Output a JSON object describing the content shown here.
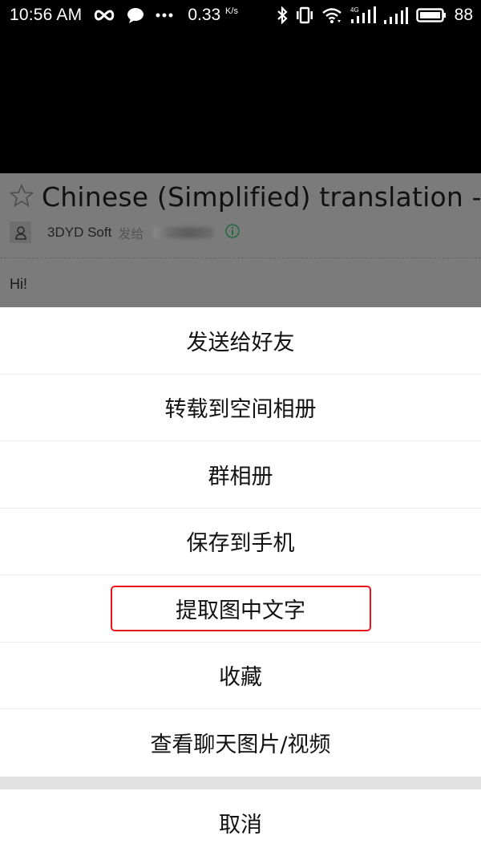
{
  "status_bar": {
    "time": "10:56 AM",
    "icons_left": [
      "infinity-icon",
      "chat-bubble-icon",
      "more-dots-icon"
    ],
    "net_speed_value": "0.33",
    "net_speed_unit": "K/s",
    "icons_right": [
      "bluetooth-icon",
      "vibrate-icon",
      "wifi-icon",
      "signal-4g-icon",
      "signal-icon",
      "battery-icon"
    ],
    "network_type": "4G",
    "battery_percent": "88"
  },
  "email_preview": {
    "title": "Chinese (Simplified) translation - ",
    "sender": "3DYD Soft",
    "sent_to_label": "发给",
    "recipient": "(blurred)",
    "body_text": "Hi!"
  },
  "action_sheet": {
    "items": [
      {
        "label": "发送给好友"
      },
      {
        "label": "转载到空间相册"
      },
      {
        "label": "群相册"
      },
      {
        "label": "保存到手机"
      },
      {
        "label": "提取图中文字",
        "highlighted": true
      },
      {
        "label": "收藏"
      },
      {
        "label": "查看聊天图片/视频"
      }
    ],
    "cancel_label": "取消",
    "highlight_color": "#e8141b"
  }
}
